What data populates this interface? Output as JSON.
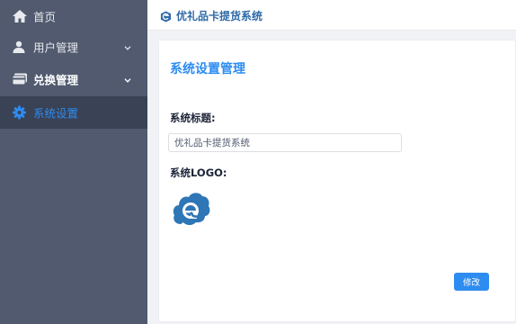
{
  "app": {
    "title": "优礼品卡提货系统"
  },
  "sidebar": {
    "items": [
      {
        "label": "首页",
        "icon": "home-icon"
      },
      {
        "label": "用户管理",
        "icon": "user-icon"
      },
      {
        "label": "兑换管理",
        "icon": "card-icon"
      },
      {
        "label": "系统设置",
        "icon": "gear-icon"
      }
    ]
  },
  "page": {
    "heading": "系统设置管理",
    "title_label": "系统标题:",
    "title_value": "优礼品卡提货系统",
    "logo_label": "系统LOGO:",
    "submit_label": "修改"
  },
  "colors": {
    "accent": "#2d8cf0",
    "sidebar": "#515a6e",
    "sidebar_active": "#3a4256"
  }
}
